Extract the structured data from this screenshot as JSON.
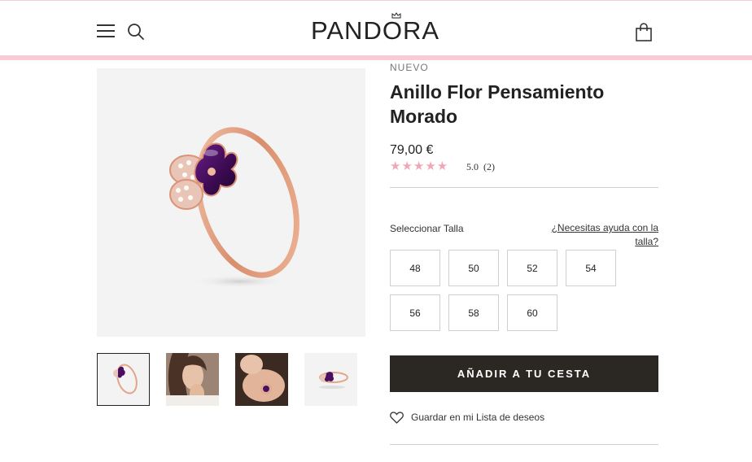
{
  "header": {
    "logo": "PANDORA",
    "icons": {
      "menu": "hamburger-menu-icon",
      "search": "search-icon",
      "bag": "shopping-bag-icon"
    },
    "accent_color": "#f7ccd6"
  },
  "gallery": {
    "thumbnails": [
      "ring-product",
      "model-smiling",
      "hand-wearing-ring",
      "ring-side-view"
    ],
    "selected_index": 0
  },
  "product": {
    "badge": "NUEVO",
    "title": "Anillo Flor Pensamiento Morado",
    "price": "79,00 €",
    "stars": "★★★★★",
    "rating": "5.0",
    "review_count": "(2)"
  },
  "sizes": {
    "label": "Seleccionar Talla",
    "help_link": "¿Necesitas ayuda con la talla?",
    "options": [
      "48",
      "50",
      "52",
      "54",
      "56",
      "58",
      "60"
    ]
  },
  "actions": {
    "add_to_cart": "AÑADIR A TU CESTA",
    "wishlist": "Guardar en mi Lista de deseos"
  },
  "colors": {
    "button_bg": "#2b2824",
    "star_color": "#f0a7b8",
    "ring_metal": "#e3a58a",
    "petal_purple": "#4a0f63"
  }
}
